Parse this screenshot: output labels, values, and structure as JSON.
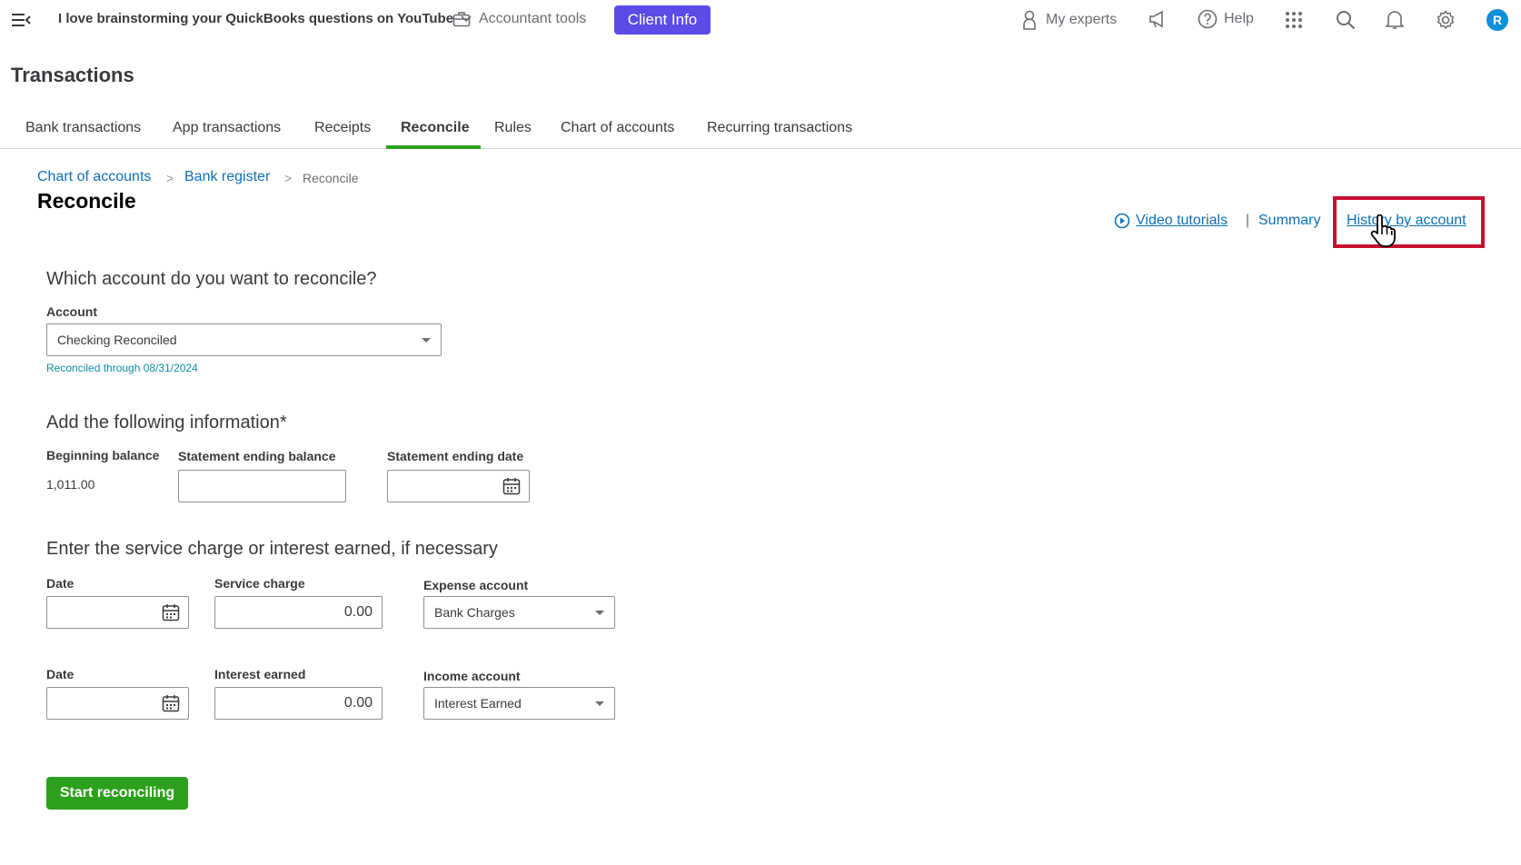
{
  "topbar": {
    "company_name": "I love brainstorming your QuickBooks questions on YouTube",
    "accountant_tools": "Accountant tools",
    "client_info": "Client Info",
    "my_experts": "My experts",
    "help": "Help",
    "avatar_initial": "R",
    "icons": [
      "menu-icon",
      "chevron-down-icon",
      "briefcase-icon",
      "person-icon",
      "megaphone-icon",
      "question-icon",
      "apps-grid-icon",
      "search-icon",
      "bell-icon",
      "gear-icon"
    ]
  },
  "page": {
    "title": "Transactions"
  },
  "tabs": [
    {
      "label": "Bank transactions"
    },
    {
      "label": "App transactions"
    },
    {
      "label": "Receipts"
    },
    {
      "label": "Reconcile",
      "active": true
    },
    {
      "label": "Rules"
    },
    {
      "label": "Chart of accounts"
    },
    {
      "label": "Recurring transactions"
    }
  ],
  "breadcrumb": {
    "items": [
      "Chart of accounts",
      "Bank register"
    ],
    "separator": ">",
    "current": "Reconcile"
  },
  "heading": "Reconcile",
  "header_links": {
    "video_tutorials": "Video tutorials",
    "pipe": "|",
    "summary": "Summary",
    "history_by_account": "History by account"
  },
  "account_section": {
    "title": "Which account do you want to reconcile?",
    "account_label": "Account",
    "account_value": "Checking Reconciled",
    "reconciled_note": "Reconciled through 08/31/2024"
  },
  "info_section": {
    "title": "Add the following information*",
    "beginning_balance_label": "Beginning balance",
    "beginning_balance_value": "1,011.00",
    "ending_balance_label": "Statement ending balance",
    "ending_balance_value": "",
    "ending_date_label": "Statement ending date",
    "ending_date_value": ""
  },
  "charges_section": {
    "title": "Enter the service charge or interest earned, if necessary",
    "service_row": {
      "date_label": "Date",
      "date_value": "",
      "amount_label": "Service charge",
      "amount_value": "0.00",
      "account_label": "Expense account",
      "account_value": "Bank Charges"
    },
    "interest_row": {
      "date_label": "Date",
      "date_value": "",
      "amount_label": "Interest earned",
      "amount_value": "0.00",
      "account_label": "Income account",
      "account_value": "Interest Earned"
    }
  },
  "start_button": "Start reconciling",
  "colors": {
    "brand_green": "#2ca01c",
    "link_blue": "#0d6fb8",
    "client_info_purple": "#5b4ce8",
    "highlight_red": "#c8102e",
    "avatar_blue": "#0d8fd9"
  }
}
